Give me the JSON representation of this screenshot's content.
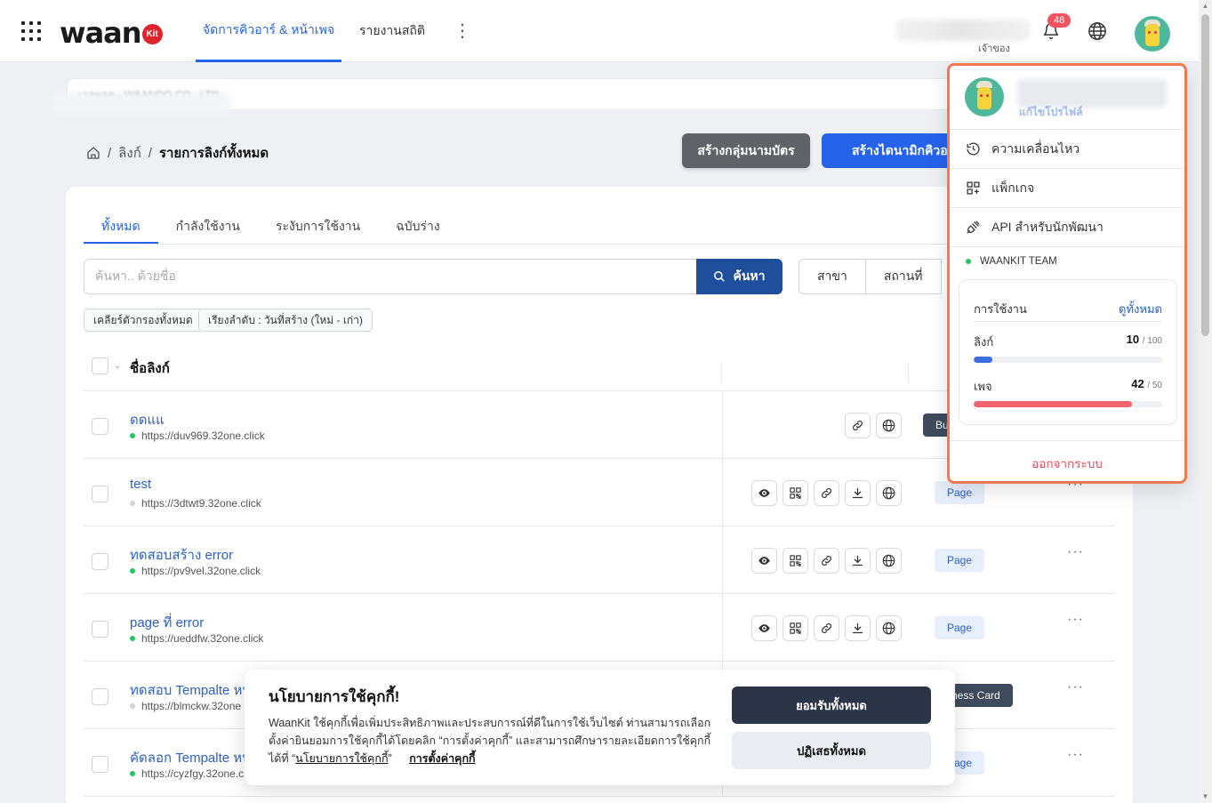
{
  "header": {
    "logo_text": "waan",
    "logo_badge": "Kit",
    "nav_tabs": [
      {
        "label": "จัดการคิวอาร์ & หน้าเพจ",
        "active": true
      },
      {
        "label": "รายงานสถิติ",
        "active": false
      }
    ],
    "owner_label": "เจ้าของ",
    "notification_count": "48"
  },
  "workspace": {
    "text": "เวลพอต - WAANDO CO., LTD."
  },
  "breadcrumb": {
    "items": [
      "ลิงก์",
      "รายการลิงก์ทั้งหมด"
    ],
    "separator": "/"
  },
  "actions": {
    "create_group": "สร้างกลุ่มนามบัตร",
    "create_dynamic": "สร้างไดนามิกคิวอาร์"
  },
  "tabs": [
    {
      "label": "ทั้งหมด",
      "active": true
    },
    {
      "label": "กำลังใช้งาน",
      "active": false
    },
    {
      "label": "ระงับการใช้งาน",
      "active": false
    },
    {
      "label": "ฉบับร่าง",
      "active": false
    }
  ],
  "search": {
    "placeholder": "ค้นหา.. ด้วยชื่อ",
    "button": "ค้นหา"
  },
  "filters": [
    "สาขา",
    "สถานที่"
  ],
  "chips": {
    "clear": "เคลียร์ตัวกรองทั้งหมด",
    "sort": "เรียงลำดับ : วันที่สร้าง (ใหม่ - เก่า)"
  },
  "table": {
    "header_name": "ชื่อลิงก์",
    "rows": [
      {
        "name": "ดดแแ",
        "url": "https://duv969.32one.click",
        "status": "green",
        "badge": "Bu",
        "badge_type": "bc",
        "icons": [
          "link",
          "globe"
        ]
      },
      {
        "name": "test",
        "url": "https://3dtwt9.32one.click",
        "status": "gray",
        "badge": "Page",
        "badge_type": "page",
        "icons": [
          "eye",
          "qr",
          "link",
          "download",
          "globe"
        ]
      },
      {
        "name": "ทดสอบสร้าง error",
        "url": "https://pv9vel.32one.click",
        "status": "green",
        "badge": "Page",
        "badge_type": "page",
        "icons": [
          "eye",
          "qr",
          "link",
          "download",
          "globe"
        ]
      },
      {
        "name": "page ที่ error",
        "url": "https://ueddfw.32one.click",
        "status": "green",
        "badge": "Page",
        "badge_type": "page",
        "icons": [
          "eye",
          "qr",
          "link",
          "download",
          "globe"
        ]
      },
      {
        "name": "ทดสอบ Tempalte หน้",
        "url": "https://blmckw.32one",
        "status": "gray",
        "badge": "ness Card",
        "badge_type": "bc",
        "icons": []
      },
      {
        "name": "คัดลอก Tempalte หน้",
        "url": "https://cyzfgy.32one.c",
        "status": "green",
        "badge": "Page",
        "badge_type": "page",
        "icons": []
      }
    ],
    "more_label": "···"
  },
  "cookie": {
    "title": "นโยบายการใช้คุกกี้!",
    "body": "WaanKit ใช้คุกกี้เพื่อเพิ่มประสิทธิภาพและประสบการณ์ที่ดีในการใช้เว็บไซต์ ท่านสามารถเลือกตั้งค่ายินยอมการใช้คุกกี้ได้โดยคลิก “การตั้งค่าคุกกี้” และสามารถศึกษารายละเอียดการใช้คุกกี้ได้ที่ “",
    "policy_link": "นโยบายการใช้คุกกี้",
    "quote_end": "”",
    "settings_link": "การตั้งค่าคุกกี้",
    "accept": "ยอมรับทั้งหมด",
    "reject": "ปฏิเสธทั้งหมด"
  },
  "dropdown": {
    "edit_profile": "แก้ไขโปรไฟล์",
    "items": [
      {
        "label": "ความเคลื่อนไหว",
        "icon": "history-icon"
      },
      {
        "label": "แพ็กเกจ",
        "icon": "package-icon"
      },
      {
        "label": "API สำหรับนักพัฒนา",
        "icon": "plug-icon"
      }
    ],
    "team": "WAANKIT TEAM",
    "usage": {
      "title": "การใช้งาน",
      "view_all": "ดูทั้งหมด",
      "links_label": "ลิงก์",
      "links_used": "10",
      "links_total": "/ 100",
      "links_fraction": 0.1,
      "pages_label": "เพจ",
      "pages_used": "42",
      "pages_total": "/ 50",
      "pages_fraction": 0.84
    },
    "logout": "ออกจากระบบ"
  },
  "colors": {
    "accent": "#2563eb",
    "links_bar": "#3b6fe0",
    "pages_bar": "#f0636f",
    "logout": "#ec4e5c",
    "dropdown_border": "#f07a4f"
  }
}
